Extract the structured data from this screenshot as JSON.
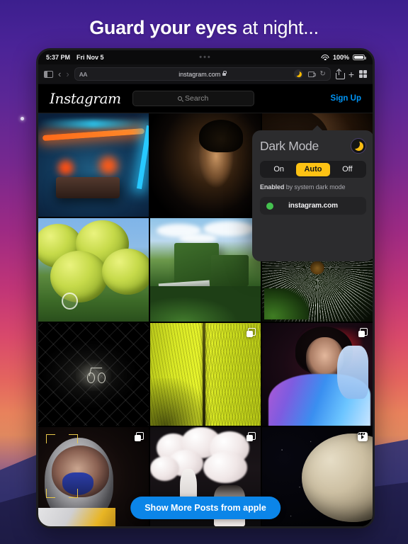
{
  "headline": {
    "bold_part": "Guard your eyes",
    "normal_part": " at night..."
  },
  "device": {
    "status_bar": {
      "time": "5:37 PM",
      "date": "Fri Nov 5",
      "center_dots": "•••",
      "wifi_icon": "wifi-icon",
      "battery_percent": "100%",
      "battery_icon": "battery-full-icon"
    },
    "toolbar": {
      "sidebar_icon": "sidebar-icon",
      "back_icon": "‹",
      "forward_icon": "›",
      "text_size_label": "AA",
      "url": "instagram.com",
      "lock_icon": "lock-icon",
      "dark_mode_icon": "moon-icon",
      "extension_icon": "extension-icon",
      "reload_icon": "↻",
      "share_icon": "share-icon",
      "new_tab_icon": "+",
      "tabs_icon": "tab-grid-icon"
    }
  },
  "site": {
    "logo": "Instagram",
    "search": {
      "placeholder": "Search",
      "icon": "search-icon"
    },
    "signup_label": "Sign Up",
    "show_more_label": "Show More Posts from apple",
    "grid": [
      {
        "name": "neon-gas-station",
        "badge": "none"
      },
      {
        "name": "woman-profile-portrait",
        "badge": "none"
      },
      {
        "name": "woman-with-earring",
        "badge": "none"
      },
      {
        "name": "green-grapes",
        "badge": "none"
      },
      {
        "name": "ivy-covered-building",
        "badge": "none"
      },
      {
        "name": "dandelion-seedhead",
        "badge": "multi"
      },
      {
        "name": "bicycle-behind-fence",
        "badge": "none"
      },
      {
        "name": "yellow-feather",
        "badge": "multi"
      },
      {
        "name": "neon-lit-portrait",
        "badge": "multi"
      },
      {
        "name": "astronaut-helmet",
        "badge": "multi"
      },
      {
        "name": "white-clouds-set",
        "badge": "multi"
      },
      {
        "name": "moon-in-space",
        "badge": "reel"
      }
    ]
  },
  "popover": {
    "title": "Dark Mode",
    "moon_icon": "moon-icon",
    "segments": [
      {
        "label": "On",
        "active": false
      },
      {
        "label": "Auto",
        "active": true
      },
      {
        "label": "Off",
        "active": false
      }
    ],
    "status_prefix": "Enabled",
    "status_suffix": " by system dark mode",
    "site_entry": {
      "dot_color": "#44c14f",
      "name": "instagram.com"
    }
  },
  "colors": {
    "accent_yellow": "#fdc214",
    "instagram_blue": "#0b85e8",
    "status_green": "#44c14f",
    "popover_bg": "#2c2c2e"
  }
}
